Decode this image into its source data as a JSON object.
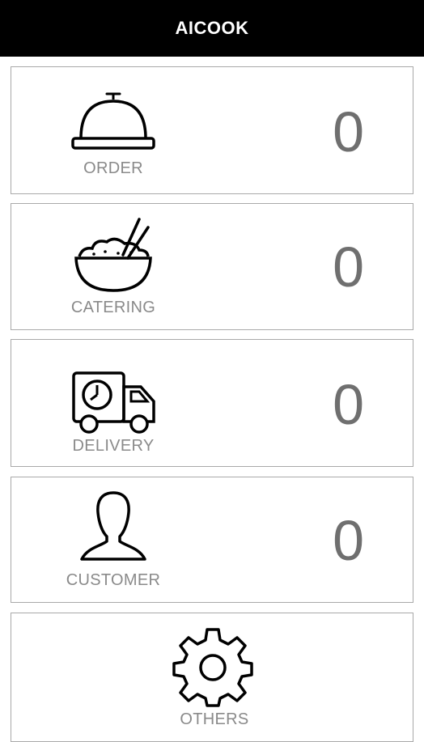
{
  "header": {
    "title": "AICOOK"
  },
  "menu": [
    {
      "label": "ORDER",
      "count": "0",
      "icon": "cloche-icon"
    },
    {
      "label": "CATERING",
      "count": "0",
      "icon": "rice-bowl-icon"
    },
    {
      "label": "DELIVERY",
      "count": "0",
      "icon": "delivery-truck-icon"
    },
    {
      "label": "CUSTOMER",
      "count": "0",
      "icon": "person-icon"
    },
    {
      "label": "OTHERS",
      "icon": "gear-icon"
    }
  ],
  "colors": {
    "header_bg": "#000000",
    "header_text": "#ffffff",
    "label_text": "#8a8a8a",
    "count_text": "#6f6f6f",
    "card_border": "#a9a9a9"
  }
}
